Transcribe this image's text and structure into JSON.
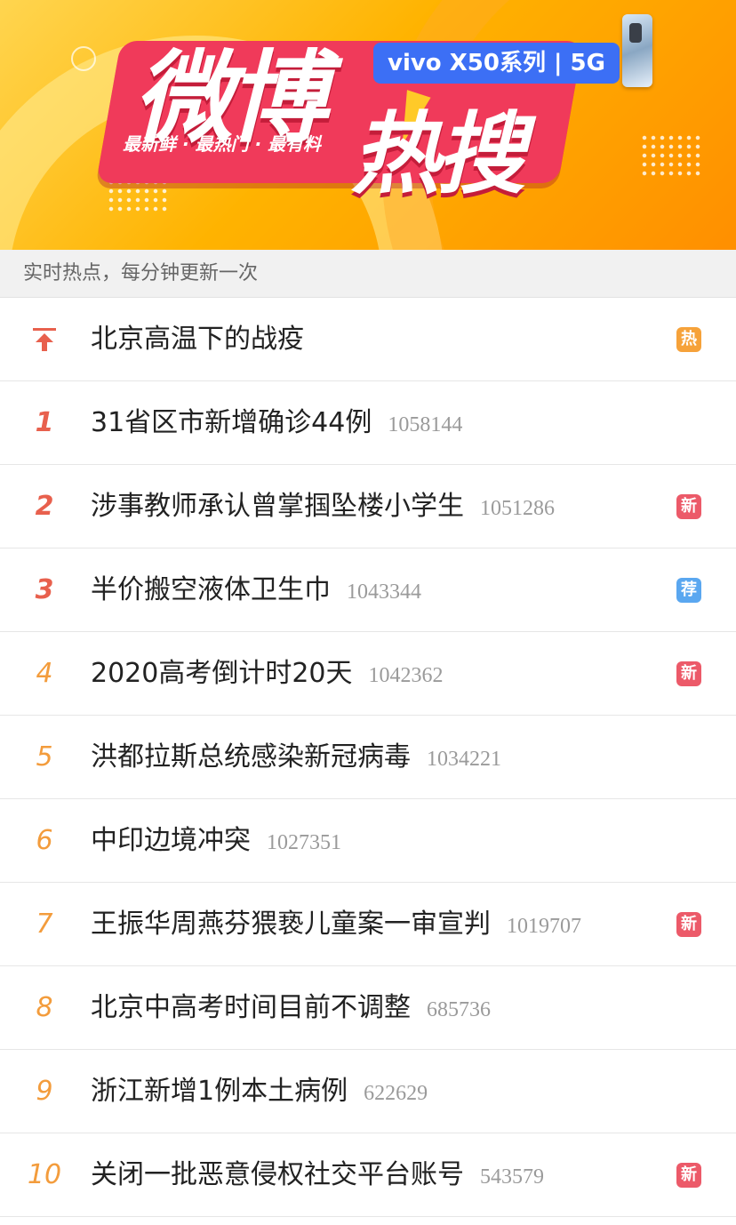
{
  "banner": {
    "title_part1": "微博",
    "title_part2": "热搜",
    "slogan": "最新鲜 · 最热门 · 最有料",
    "sponsor": "vivo X50系列 | 5G"
  },
  "subheader": "实时热点，每分钟更新一次",
  "rows": [
    {
      "rank": "",
      "pinned": true,
      "topic": "北京高温下的战疫",
      "count": "",
      "badge": "热",
      "badge_type": "hot"
    },
    {
      "rank": "1",
      "topic": "31省区市新增确诊44例",
      "count": "1058144",
      "badge": "",
      "badge_type": ""
    },
    {
      "rank": "2",
      "topic": "涉事教师承认曾掌掴坠楼小学生",
      "count": "1051286",
      "badge": "新",
      "badge_type": "new"
    },
    {
      "rank": "3",
      "topic": "半价搬空液体卫生巾",
      "count": "1043344",
      "badge": "荐",
      "badge_type": "rec"
    },
    {
      "rank": "4",
      "topic": "2020高考倒计时20天",
      "count": "1042362",
      "badge": "新",
      "badge_type": "new"
    },
    {
      "rank": "5",
      "topic": "洪都拉斯总统感染新冠病毒",
      "count": "1034221",
      "badge": "",
      "badge_type": ""
    },
    {
      "rank": "6",
      "topic": "中印边境冲突",
      "count": "1027351",
      "badge": "",
      "badge_type": ""
    },
    {
      "rank": "7",
      "topic": "王振华周燕芬猥亵儿童案一审宣判",
      "count": "1019707",
      "badge": "新",
      "badge_type": "new"
    },
    {
      "rank": "8",
      "topic": "北京中高考时间目前不调整",
      "count": "685736",
      "badge": "",
      "badge_type": ""
    },
    {
      "rank": "9",
      "topic": "浙江新增1例本土病例",
      "count": "622629",
      "badge": "",
      "badge_type": ""
    },
    {
      "rank": "10",
      "topic": "关闭一批恶意侵权社交平台账号",
      "count": "543579",
      "badge": "新",
      "badge_type": "new"
    }
  ],
  "colors": {
    "rank_top3": "#e8604d",
    "rank_other": "#f39c3c",
    "badge_hot": "#f6a23a",
    "badge_new": "#ec5a69",
    "badge_rec": "#5aa7f0"
  }
}
